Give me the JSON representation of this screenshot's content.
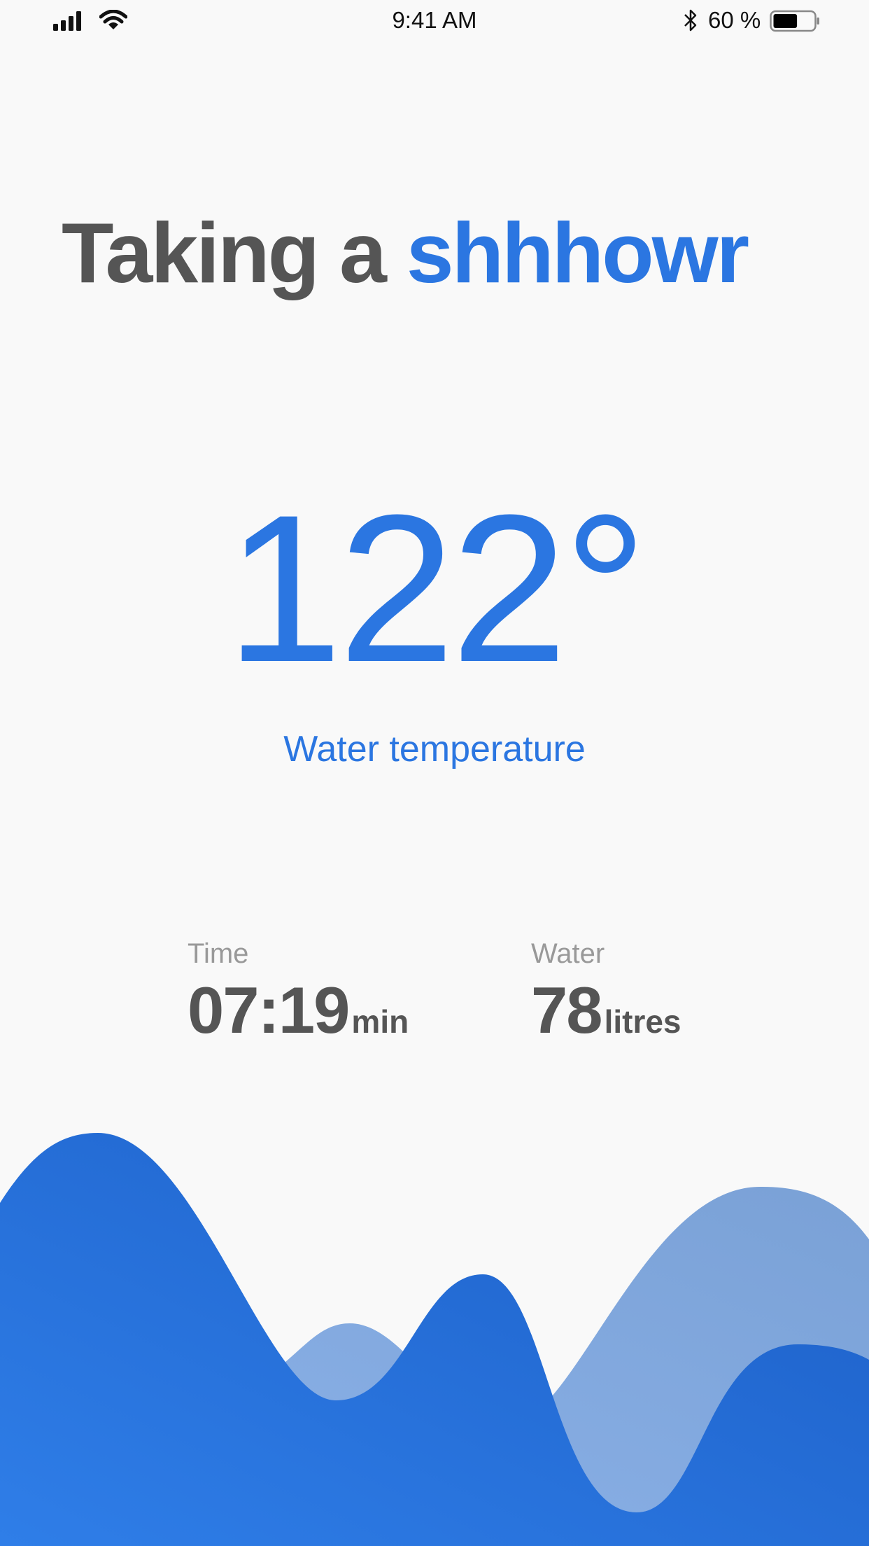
{
  "status_bar": {
    "time": "9:41 AM",
    "battery_percent": "60 %",
    "battery_level": 0.6,
    "icons": [
      "signal-icon",
      "wifi-icon",
      "bluetooth-icon",
      "battery-icon"
    ]
  },
  "title": {
    "prefix": "Taking a",
    "highlight": "shhhowr"
  },
  "temperature": {
    "value": "122°",
    "label": "Water temperature"
  },
  "stats": {
    "time": {
      "label": "Time",
      "value": "07:19",
      "unit": "min"
    },
    "water": {
      "label": "Water",
      "value": "78",
      "unit": "litres"
    }
  },
  "colors": {
    "background": "#f9f9f9",
    "accent": "#2b76e1",
    "text_dark": "#555555",
    "text_muted": "#999999",
    "wave_light": "#86aee6",
    "wave_dark": "#2a73e0"
  }
}
